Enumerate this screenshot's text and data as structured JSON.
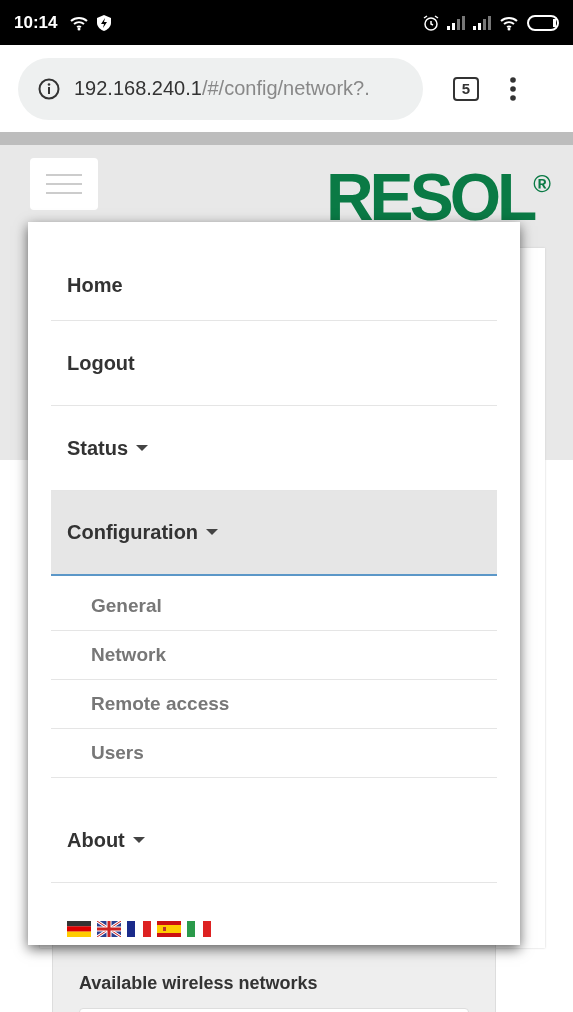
{
  "status_bar": {
    "time": "10:14"
  },
  "browser": {
    "url_host": "192.168.240.1",
    "url_path": "/#/config/network?.",
    "tab_count": "5"
  },
  "logo": {
    "text": "RESOL$^{®}$"
  },
  "menu": {
    "items": [
      {
        "label": "Home",
        "kind": "link",
        "selected": false
      },
      {
        "label": "Logout",
        "kind": "link",
        "selected": false
      },
      {
        "label": "Status",
        "kind": "dropdown",
        "selected": false
      },
      {
        "label": "Configuration",
        "kind": "dropdown",
        "selected": true,
        "children": [
          {
            "label": "General"
          },
          {
            "label": "Network"
          },
          {
            "label": "Remote access"
          },
          {
            "label": "Users"
          }
        ]
      },
      {
        "label": "About",
        "kind": "dropdown",
        "selected": false
      }
    ],
    "languages": [
      {
        "kind": "de"
      },
      {
        "kind": "gb"
      },
      {
        "kind": "fr"
      },
      {
        "kind": "es"
      },
      {
        "kind": "it"
      }
    ]
  },
  "section": {
    "title": "Available wireless networks"
  }
}
